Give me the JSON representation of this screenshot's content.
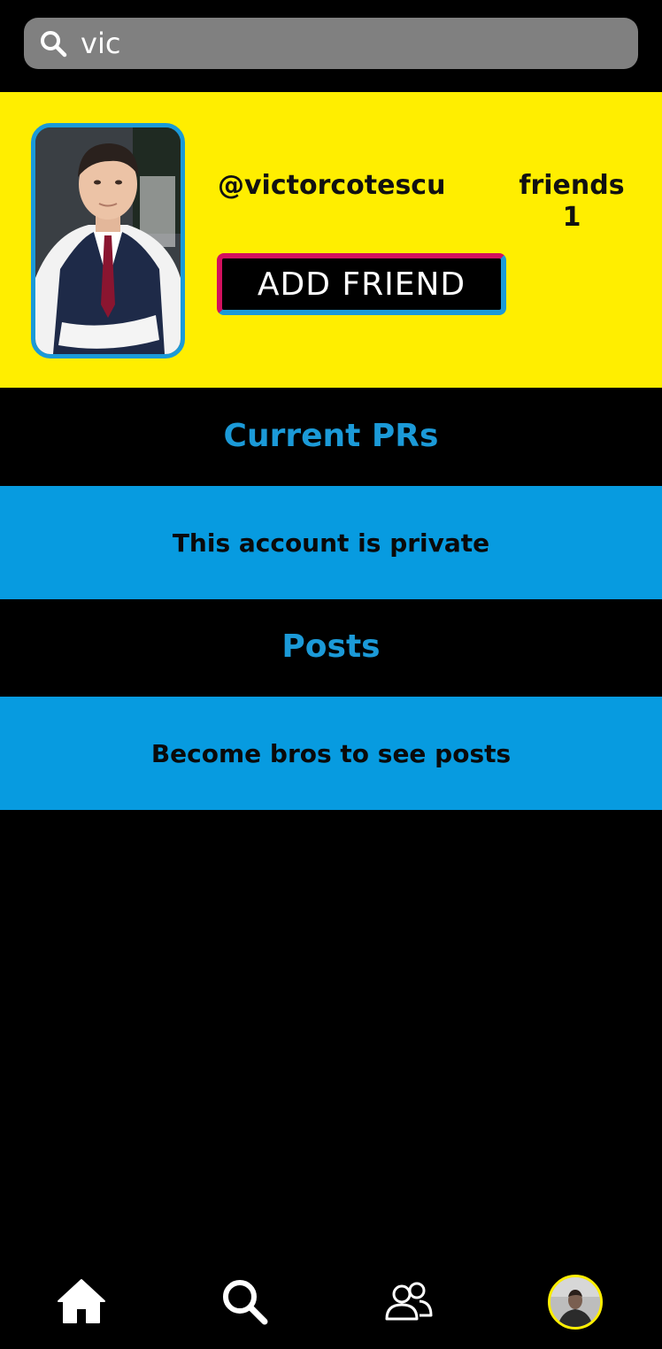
{
  "search": {
    "value": "vic",
    "icon": "search-icon"
  },
  "profile": {
    "username": "@victorcotescu",
    "friends_label": "friends",
    "friends_count": "1",
    "add_friend_label": "ADD FRIEND"
  },
  "sections": {
    "prs_heading": "Current PRs",
    "prs_message": "This account is private",
    "posts_heading": "Posts",
    "posts_message": "Become bros to see posts"
  },
  "nav": {
    "items": [
      {
        "icon": "home-icon"
      },
      {
        "icon": "search-icon"
      },
      {
        "icon": "friends-icon"
      },
      {
        "icon": "profile-avatar"
      }
    ]
  },
  "colors": {
    "card_bg": "#ffee00",
    "accent_blue": "#1b9ad8",
    "banner_blue": "#079be0",
    "accent_pink": "#d3105e",
    "search_bg": "#808080",
    "page_bg": "#000000"
  }
}
